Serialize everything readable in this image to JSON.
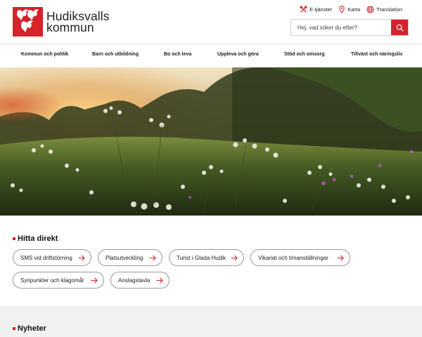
{
  "header": {
    "logo_line1": "Hudiksvalls",
    "logo_line2": "kommun",
    "util_links": [
      {
        "label": "E-tjänster",
        "icon": "tools-icon"
      },
      {
        "label": "Karta",
        "icon": "map-pin-icon"
      },
      {
        "label": "Translation",
        "icon": "globe-icon"
      }
    ],
    "search": {
      "placeholder": "Hej, vad söker du efter?",
      "button_icon": "search-icon"
    }
  },
  "nav": {
    "items": [
      {
        "label": "Kommun och politik"
      },
      {
        "label": "Barn och utbildning"
      },
      {
        "label": "Bo och leva"
      },
      {
        "label": "Uppleva och göra"
      },
      {
        "label": "Stöd och omsorg"
      },
      {
        "label": "Tillväxt och näringsliv"
      }
    ]
  },
  "hitta_direkt": {
    "title": "Hitta direkt",
    "links": [
      {
        "label": "SMS vid driftstörning"
      },
      {
        "label": "Platsutveckling"
      },
      {
        "label": "Turist i Glada Hudik"
      },
      {
        "label": "Vikariat och timanställningar"
      },
      {
        "label": "Synpunkter och klagomål"
      },
      {
        "label": "Anslagstavla"
      }
    ]
  },
  "news": {
    "title": "Nyheter"
  },
  "colors": {
    "brand_red": "#d6222a",
    "section_grey": "#f1f1f1"
  }
}
